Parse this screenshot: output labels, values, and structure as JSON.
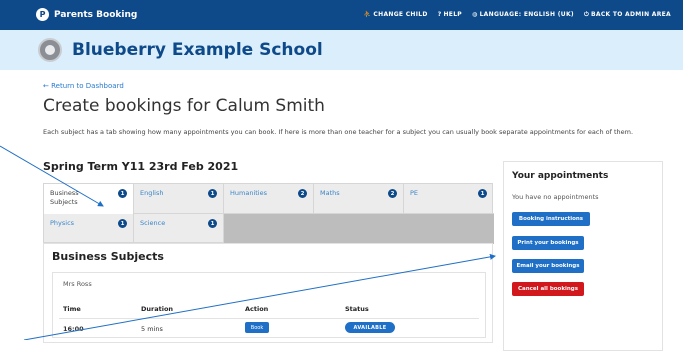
{
  "topbar": {
    "brand": "Parents Booking",
    "brand_logo_letter": "P",
    "nav": [
      {
        "icon": "people-icon",
        "glyph": "⛹",
        "label": "CHANGE CHILD"
      },
      {
        "icon": "help-icon",
        "glyph": "?",
        "label": "HELP"
      },
      {
        "icon": "globe-icon",
        "glyph": "◍",
        "label": "LANGUAGE: ENGLISH (UK)"
      },
      {
        "icon": "power-icon",
        "glyph": "⏻",
        "label": "BACK TO ADMIN AREA"
      }
    ]
  },
  "school": {
    "name": "Blueberry Example School"
  },
  "back_link": "← Return to Dashboard",
  "page_title": "Create bookings for Calum Smith",
  "intro": "Each subject has a tab showing how many appointments you can book. If here is more than one teacher for a subject you can usually book separate appointments for each of them.",
  "term_title": "Spring Term Y11 23rd Feb 2021",
  "tabs": [
    {
      "label": "Business Subjects",
      "count": "1"
    },
    {
      "label": "English",
      "count": "1"
    },
    {
      "label": "Humanities",
      "count": "2"
    },
    {
      "label": "Maths",
      "count": "2"
    },
    {
      "label": "PE",
      "count": "1"
    },
    {
      "label": "Physics",
      "count": "1"
    },
    {
      "label": "Science",
      "count": "1"
    }
  ],
  "panel": {
    "title": "Business Subjects",
    "teacher": "Mrs Ross",
    "headers": {
      "time": "Time",
      "duration": "Duration",
      "action": "Action",
      "status": "Status"
    },
    "row": {
      "time": "16:00",
      "duration": "5 mins",
      "action": "Book",
      "status": "AVAILABLE"
    }
  },
  "appointments": {
    "title": "Your appointments",
    "empty": "You have no appointments",
    "buttons": [
      "Booking instructions",
      "Print your bookings",
      "Email your bookings",
      "Cancel all bookings"
    ]
  },
  "colors": {
    "brand": "#0e4a8a",
    "accent": "#1f6fc6",
    "danger": "#d0181d",
    "school_bar": "#dbeefb"
  }
}
